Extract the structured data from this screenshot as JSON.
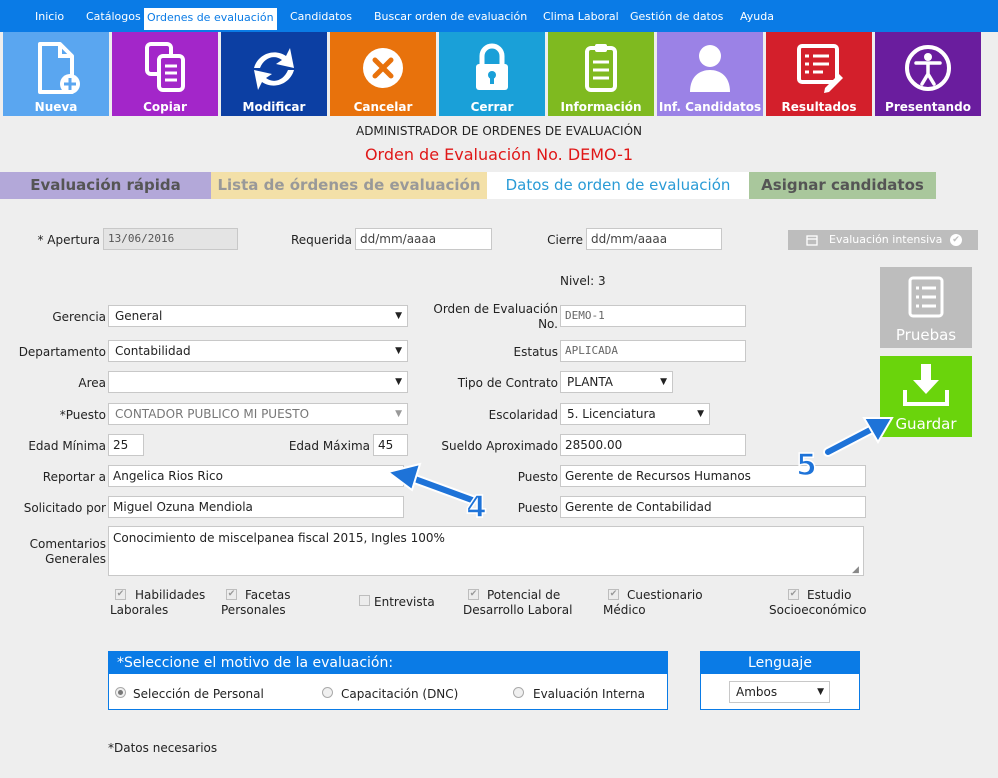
{
  "nav": {
    "items": [
      {
        "label": "Inicio",
        "active": false
      },
      {
        "label": "Catálogos",
        "active": false
      },
      {
        "label": "Ordenes de evaluación",
        "active": true
      },
      {
        "label": "Candidatos",
        "active": false
      },
      {
        "label": "Buscar orden de evaluación",
        "active": false
      },
      {
        "label": "Clima Laboral",
        "active": false
      },
      {
        "label": "Gestión de datos",
        "active": false
      },
      {
        "label": "Ayuda",
        "active": false
      }
    ]
  },
  "tiles": [
    {
      "label": "Nueva",
      "icon": "new-document-icon",
      "color": "#5aa6f0"
    },
    {
      "label": "Copiar",
      "icon": "copy-icon",
      "color": "#a326c9"
    },
    {
      "label": "Modificar",
      "icon": "refresh-arrows-icon",
      "color": "#0c3fa3"
    },
    {
      "label": "Cancelar",
      "icon": "cancel-x-icon",
      "color": "#e8720c"
    },
    {
      "label": "Cerrar",
      "icon": "lock-icon",
      "color": "#1aa0d8"
    },
    {
      "label": "Información",
      "icon": "clipboard-icon",
      "color": "#7fba20"
    },
    {
      "label": "Inf. Candidatos",
      "icon": "person-icon",
      "color": "#9b82e6"
    },
    {
      "label": "Resultados",
      "icon": "report-icon",
      "color": "#d31f2b"
    },
    {
      "label": "Presentando",
      "icon": "accessibility-icon",
      "color": "#6a1d9e"
    }
  ],
  "header": {
    "title": "ADMINISTRADOR DE ORDENES DE EVALUACIÓN",
    "order_title": "Orden de Evaluación No. DEMO-1"
  },
  "tabs": [
    {
      "label": "Evaluación rápida",
      "bg": "#b3a8d9",
      "fg": "#555555"
    },
    {
      "label": "Lista de órdenes de evaluación",
      "bg": "#f3e0a8",
      "fg": "#999999"
    },
    {
      "label": "Datos de orden de evaluación",
      "bg": "#ffffff",
      "fg": "#2a9bd6"
    },
    {
      "label": "Asignar candidatos",
      "bg": "#a9c79c",
      "fg": "#555555"
    }
  ],
  "dates": {
    "apertura_label": "* Apertura",
    "apertura_value": "13/06/2016",
    "requerida_label": "Requerida",
    "requerida_placeholder": "dd/mm/aaaa",
    "cierre_label": "Cierre",
    "cierre_placeholder": "dd/mm/aaaa"
  },
  "intensive_button": "Evaluación intensiva",
  "nivel": "Nivel: 3",
  "form": {
    "gerencia_label": "Gerencia",
    "gerencia_value": "General",
    "departamento_label": "Departamento",
    "departamento_value": "Contabilidad",
    "area_label": "Area",
    "area_value": "",
    "puesto_label": "*Puesto",
    "puesto_value": "CONTADOR PUBLICO MI PUESTO",
    "edad_min_label": "Edad Mínima",
    "edad_min_value": "25",
    "edad_max_label": "Edad Máxima",
    "edad_max_value": "45",
    "reportar_label": "Reportar a",
    "reportar_value": "Angelica Rios Rico",
    "solicitado_label": "Solicitado por",
    "solicitado_value": "Miguel Ozuna Mendiola",
    "comentarios_label_1": "Comentarios",
    "comentarios_label_2": "Generales",
    "comentarios_value": "Conocimiento de miscelpanea fiscal 2015, Ingles 100%",
    "orden_label_1": "Orden de Evaluación",
    "orden_label_2": "No.",
    "orden_value": "DEMO-1",
    "estatus_label": "Estatus",
    "estatus_value": "APLICADA",
    "contrato_label": "Tipo de Contrato",
    "contrato_value": "PLANTA",
    "escolaridad_label": "Escolaridad",
    "escolaridad_value": "5. Licenciatura",
    "sueldo_label": "Sueldo Aproximado",
    "sueldo_value": "28500.00",
    "puesto1_label": "Puesto",
    "puesto1_value": "Gerente de Recursos Humanos",
    "puesto2_label": "Puesto",
    "puesto2_value": "Gerente de Contabilidad"
  },
  "side_buttons": {
    "pruebas": "Pruebas",
    "guardar": "Guardar"
  },
  "annotations": {
    "arrow4": "4",
    "arrow5": "5"
  },
  "checks": [
    {
      "line1": "Habilidades",
      "line2": "Laborales",
      "checked": true
    },
    {
      "line1": "Facetas",
      "line2": "Personales",
      "checked": true
    },
    {
      "line1": "Entrevista",
      "line2": "",
      "checked": false
    },
    {
      "line1": "Potencial de",
      "line2": "Desarrollo Laboral",
      "checked": true
    },
    {
      "line1": "Cuestionario",
      "line2": "Médico",
      "checked": true
    },
    {
      "line1": "Estudio",
      "line2": "Socioeconómico",
      "checked": true
    }
  ],
  "motivo": {
    "title": "*Seleccione el motivo de la evaluación:",
    "options": [
      {
        "label": "Selección de Personal",
        "checked": true
      },
      {
        "label": "Capacitación (DNC)",
        "checked": false
      },
      {
        "label": "Evaluación Interna",
        "checked": false
      }
    ]
  },
  "lenguaje": {
    "title": "Lenguaje",
    "value": "Ambos"
  },
  "footer_note": "*Datos necesarios"
}
